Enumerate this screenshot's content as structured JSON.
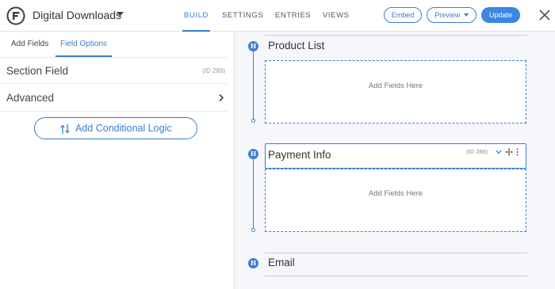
{
  "header": {
    "form_title": "Digital Downloads",
    "nav": [
      "BUILD",
      "SETTINGS",
      "ENTRIES",
      "VIEWS"
    ],
    "active_nav": "BUILD",
    "buttons": {
      "embed": "Embed",
      "preview": "Preview",
      "update": "Update"
    }
  },
  "sidebar": {
    "tabs": [
      "Add Fields",
      "Field Options"
    ],
    "active_tab": "Field Options",
    "section_field_label": "Section Field",
    "section_field_id": "(ID 289)",
    "advanced_label": "Advanced",
    "conditional_logic_label": "Add Conditional Logic"
  },
  "canvas": {
    "sections": [
      {
        "badge": "H",
        "title": "Product List",
        "dropzone_text": "Add Fields Here"
      },
      {
        "badge": "H",
        "title": "Payment Info",
        "meta": "(ID 289)",
        "dropzone_text": "Add Fields Here"
      },
      {
        "badge": "H",
        "title": "Email"
      }
    ]
  },
  "colors": {
    "accent": "#3a7ed2",
    "update_bg": "#3d86e0",
    "background": "#f6f7fb"
  },
  "icons": [
    "formidable-logo-icon",
    "caret-down-icon",
    "close-icon",
    "chevron-right-icon",
    "conditional-logic-icon",
    "heading-icon",
    "chevron-down-icon",
    "move-icon",
    "more-vertical-icon"
  ]
}
